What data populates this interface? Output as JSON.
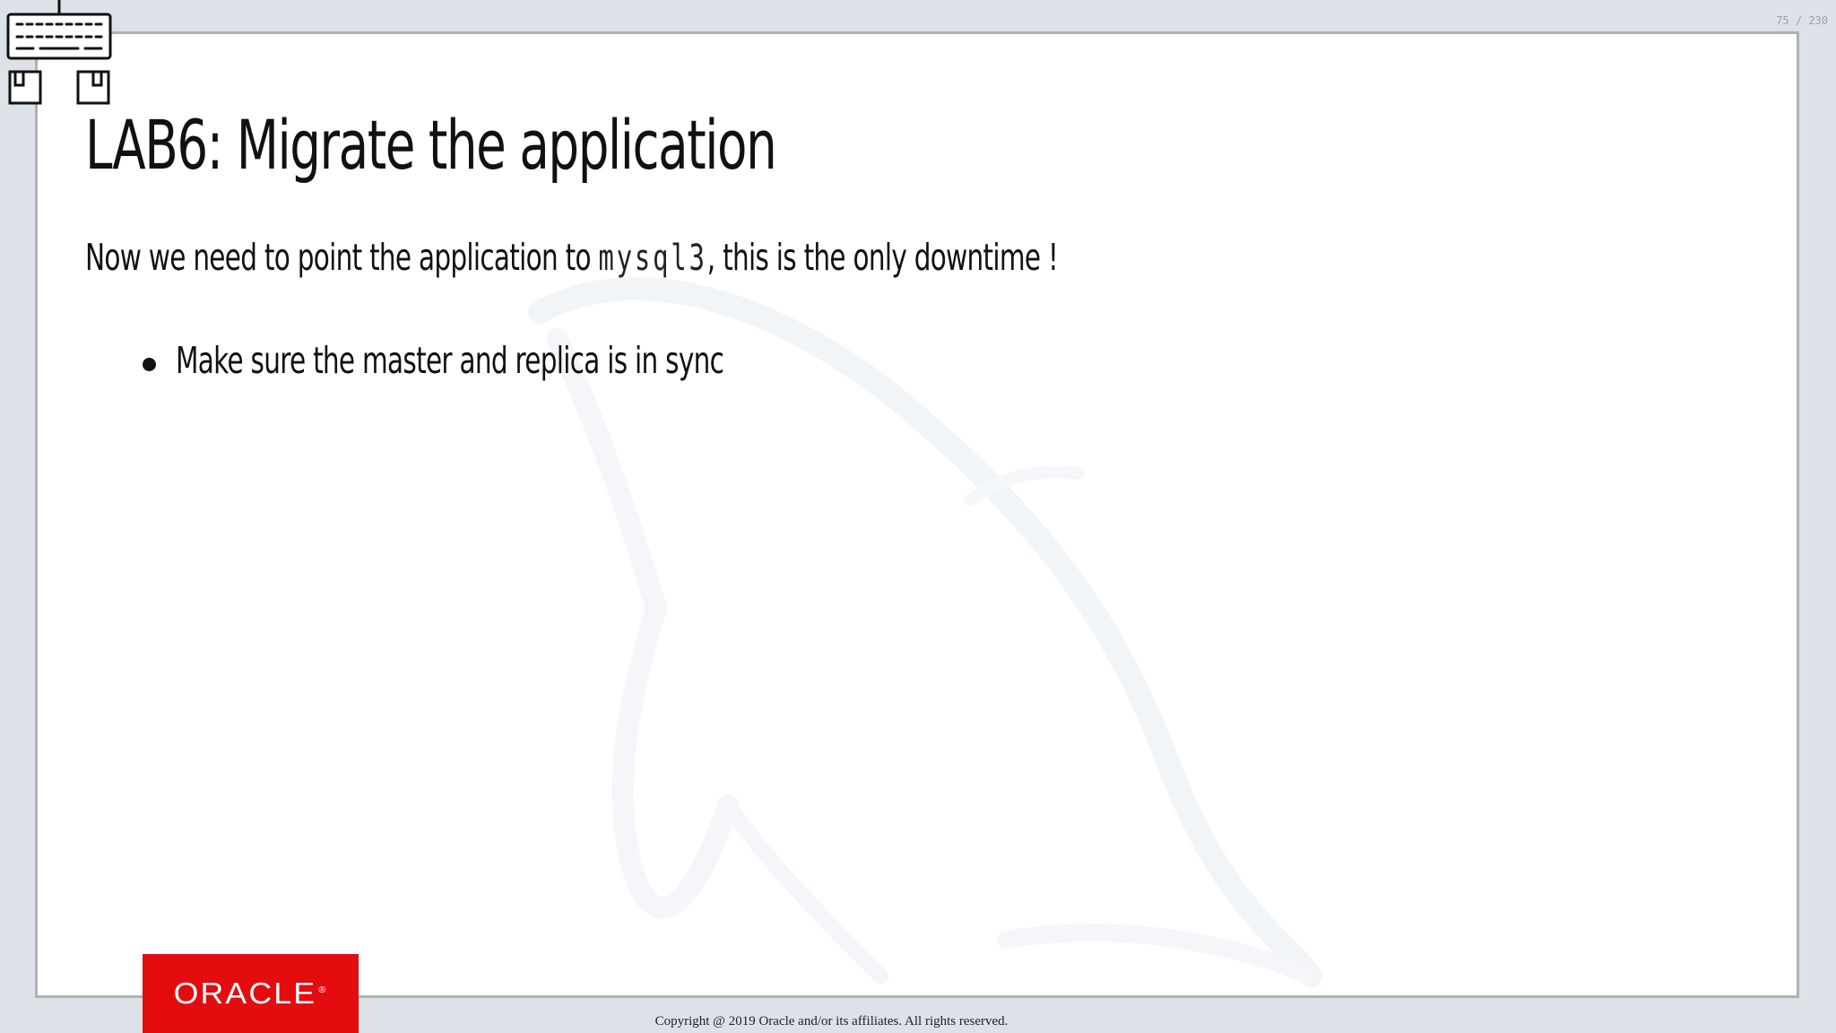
{
  "viewer": {
    "page_counter": "75 / 230"
  },
  "slide": {
    "title": "LAB6: Migrate the application",
    "intro_before": "Now we need to point the application to ",
    "intro_code": "mysql3",
    "intro_after": ", this is the only downtime !",
    "bullets": [
      "Make sure the master and replica is in sync"
    ],
    "logo": {
      "text": "ORACLE",
      "registered_mark": "®",
      "background_color": "#e30d10"
    },
    "copyright": "Copyright @ 2019 Oracle and/or its affiliates. All rights reserved.",
    "watermark_icon": "dolphin-icon"
  },
  "overlay": {
    "indicator_icon": "keyboard-mouse-icon"
  }
}
